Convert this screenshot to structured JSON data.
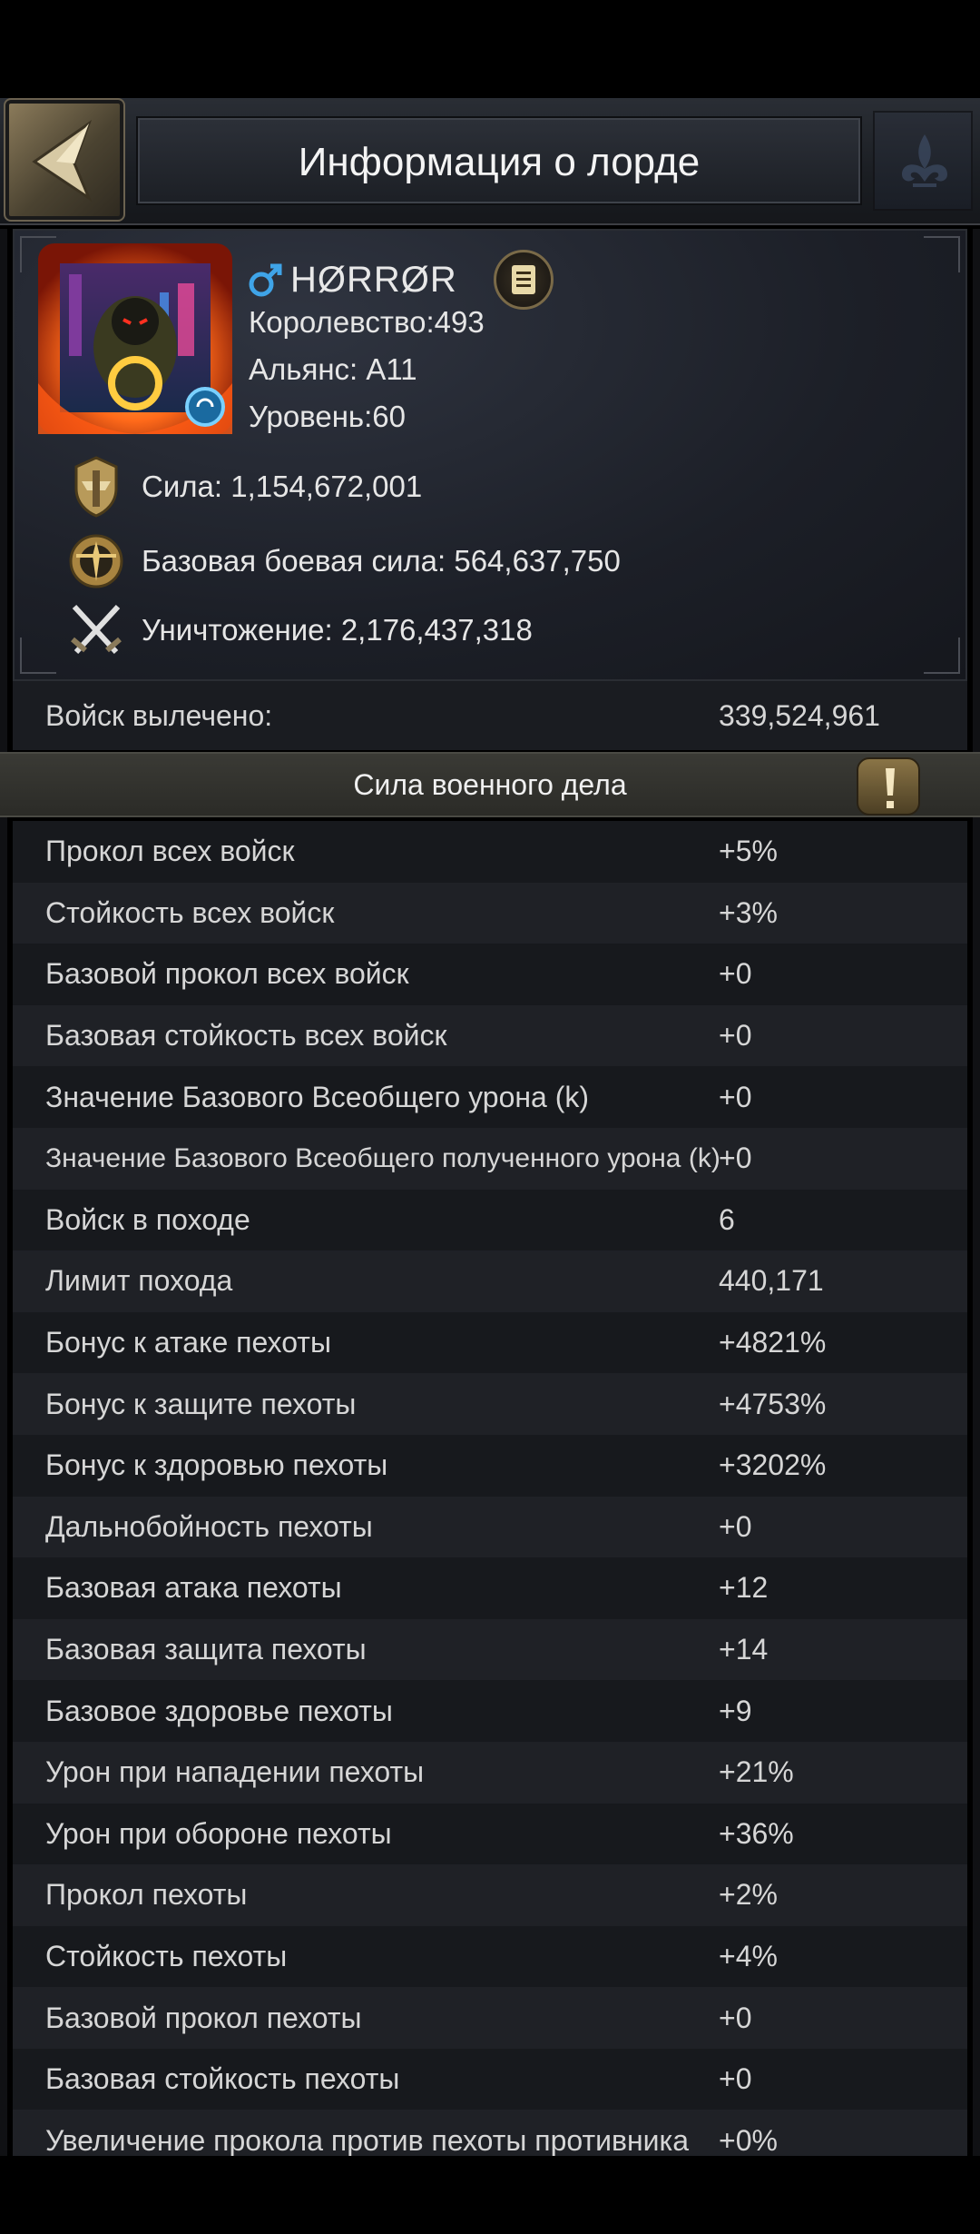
{
  "header": {
    "title": "Информация о лорде"
  },
  "lord": {
    "name": "ΗØRRØR",
    "kingdom": "Королевство:493",
    "alliance": "Альянс: A11",
    "level": "Уровень:60",
    "power": "Сила: 1,154,672,001",
    "base_combat_power": "Базовая боевая сила: 564,637,750",
    "kills": "Уничтожение: 2,176,437,318"
  },
  "healed": {
    "label": "Войск вылечено:",
    "value": "339,524,961"
  },
  "section": {
    "title": "Сила военного дела"
  },
  "stats": [
    {
      "label": "Прокол всех войск",
      "value": "+5%"
    },
    {
      "label": "Стойкость всех войск",
      "value": "+3%"
    },
    {
      "label": "Базовой прокол всех войск",
      "value": "+0"
    },
    {
      "label": "Базовая стойкость всех войск",
      "value": "+0"
    },
    {
      "label": "Значение Базового Всеобщего урона (k)",
      "value": "+0"
    },
    {
      "label": "Значение Базового Всеобщего полученного урона (k)",
      "value": "+0"
    },
    {
      "label": "Войск в походе",
      "value": "6"
    },
    {
      "label": "Лимит похода",
      "value": "440,171"
    },
    {
      "label": "Бонус к атаке пехоты",
      "value": "+4821%"
    },
    {
      "label": "Бонус к защите пехоты",
      "value": "+4753%"
    },
    {
      "label": "Бонус к здоровью пехоты",
      "value": "+3202%"
    },
    {
      "label": "Дальнобойность пехоты",
      "value": "+0"
    },
    {
      "label": "Базовая атака пехоты",
      "value": "+12"
    },
    {
      "label": "Базовая защита пехоты",
      "value": "+14"
    },
    {
      "label": "Базовое здоровье пехоты",
      "value": "+9"
    },
    {
      "label": "Урон при нападении пехоты",
      "value": "+21%"
    },
    {
      "label": "Урон при обороне пехоты",
      "value": "+36%"
    },
    {
      "label": "Прокол пехоты",
      "value": "+2%"
    },
    {
      "label": "Стойкость пехоты",
      "value": "+4%"
    },
    {
      "label": "Базовой прокол пехоты",
      "value": "+0"
    },
    {
      "label": "Базовая стойкость пехоты",
      "value": "+0"
    },
    {
      "label": "Увеличение прокола против пехоты противника",
      "value": "+0%"
    }
  ]
}
